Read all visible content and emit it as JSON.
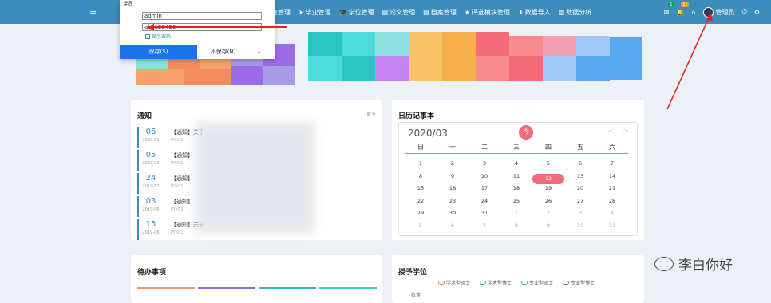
{
  "topbar": {
    "menu_icon": "≡",
    "nav": [
      {
        "icon": "📈",
        "label": "学业管理"
      },
      {
        "icon": "➤",
        "label": "毕业管理"
      },
      {
        "icon": "🎓",
        "label": "学位管理"
      },
      {
        "icon": "▤",
        "label": "论文管理"
      },
      {
        "icon": "▤",
        "label": "档案管理"
      },
      {
        "icon": "★",
        "label": "评选模块管理"
      },
      {
        "icon": "⬇",
        "label": "数据导入"
      },
      {
        "icon": "▥",
        "label": "数据分析"
      }
    ],
    "notif_count_1": "1",
    "notif_count_2": "31",
    "username": "管理员",
    "colors": {
      "bar": "#3c8dbc"
    }
  },
  "login_popup": {
    "username_value": "admin",
    "password_value": "abc123456",
    "remember_label": "显示密码",
    "save_label": "保存(S)",
    "nosave_label": "不保存(N)",
    "chevron": "⌄"
  },
  "notice": {
    "title": "通知",
    "more": "更多",
    "items": [
      {
        "day": "06",
        "ym": "2020-01",
        "text": "【通知】关于",
        "src": "PYK01"
      },
      {
        "day": "05",
        "ym": "2020-01",
        "text": "【通知】",
        "src": "PYK01"
      },
      {
        "day": "24",
        "ym": "2019-12",
        "text": "【通知】",
        "src": "PYK01"
      },
      {
        "day": "03",
        "ym": "2019-06",
        "text": "【通知】",
        "src": "PYK01"
      },
      {
        "day": "15",
        "ym": "2019-06",
        "text": "【通知】关于",
        "src": "PYK01"
      }
    ]
  },
  "calendar": {
    "title": "日历记事本",
    "month": "2020/03",
    "today_label": "今",
    "prev": "<",
    "next": ">",
    "weekdays": [
      "日",
      "一",
      "二",
      "三",
      "四",
      "五",
      "六"
    ],
    "days": [
      [
        "1",
        "2",
        "3",
        "4",
        "5",
        "6",
        "7"
      ],
      [
        "8",
        "9",
        "10",
        "11",
        "12",
        "13",
        "14"
      ],
      [
        "15",
        "16",
        "17",
        "18",
        "19",
        "20",
        "21"
      ],
      [
        "22",
        "23",
        "24",
        "25",
        "26",
        "27",
        "28"
      ],
      [
        "29",
        "30",
        "31",
        "1",
        "2",
        "3",
        "4"
      ],
      [
        "5",
        "6",
        "7",
        "8",
        "9",
        "10",
        "11"
      ]
    ],
    "selected": "12"
  },
  "todo": {
    "title": "待办事项",
    "bar_colors": [
      "#f39c6b",
      "#8e6bd6",
      "#3cb4c8",
      "#3cc8c8"
    ]
  },
  "degree": {
    "title": "授予学位",
    "legend": [
      {
        "label": "学术型硕士",
        "color": "#f0806a"
      },
      {
        "label": "学术型博士",
        "color": "#3cb4c8"
      },
      {
        "label": "专业型硕士",
        "color": "#6bb48e"
      },
      {
        "label": "专业型博士",
        "color": "#8e6bd6"
      }
    ],
    "ylabel": "数量"
  },
  "watermark": {
    "text": "李白你好"
  }
}
